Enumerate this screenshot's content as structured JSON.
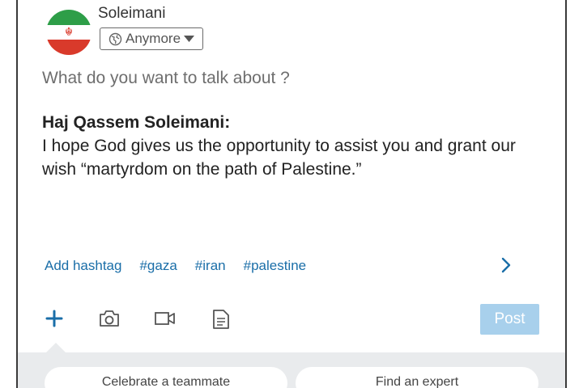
{
  "composer": {
    "author_name": "Soleimani",
    "visibility_label": "Anymore",
    "prompt_text": "What do you want to talk about ?",
    "quote_title": "Haj Qassem Soleimani:",
    "quote_body": "I hope God gives us the opportunity to assist you and grant our wish “martyrdom on the path of Palestine.”",
    "add_hashtag_label": "Add hashtag",
    "hashtags": [
      "#gaza",
      "#iran",
      "#palestine"
    ],
    "post_label": "Post"
  },
  "toolbar": {
    "icons": [
      "plus-icon",
      "camera-icon",
      "video-icon",
      "document-icon"
    ]
  },
  "suggestions": {
    "items": [
      "Celebrate a teammate",
      "Find an expert"
    ]
  },
  "colors": {
    "link_blue": "#1a6ea8",
    "post_disabled": "#a8d0ec",
    "flag_green": "#2e9e48",
    "flag_red": "#d93a2b",
    "panel_gray": "#e9ebed"
  }
}
